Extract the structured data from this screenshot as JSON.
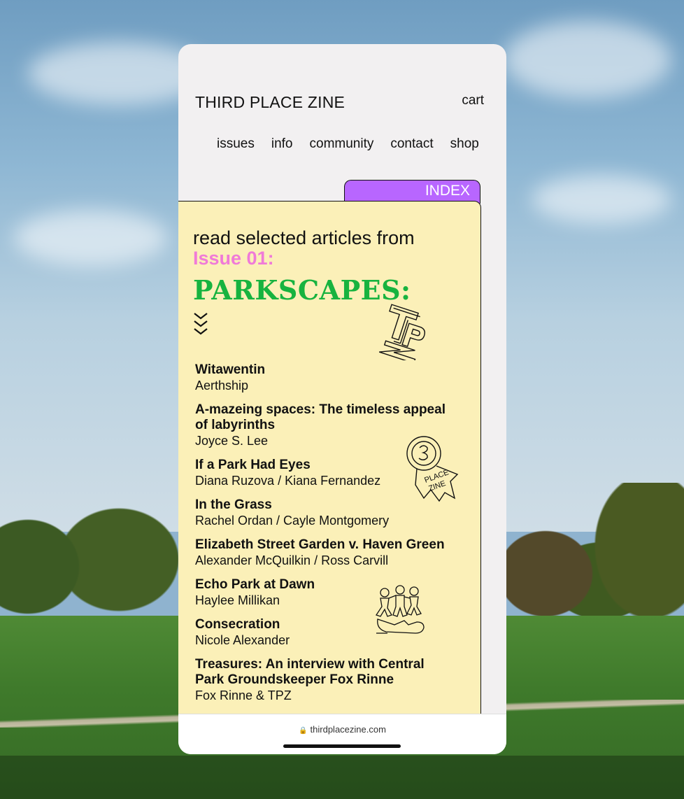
{
  "site": {
    "brand": "THIRD PLACE ZINE",
    "cart_label": "cart",
    "nav": [
      "issues",
      "info",
      "community",
      "contact",
      "shop"
    ]
  },
  "index_tab": "INDEX",
  "intro": {
    "lead": "read selected articles from ",
    "issue_label": "Issue 01:",
    "issue_title": "PARKSCAPES:"
  },
  "articles": [
    {
      "title": "Witawentin",
      "author": "Aerthship"
    },
    {
      "title": "A-mazeing spaces: The timeless appeal of labyrinths",
      "author": "Joyce S. Lee"
    },
    {
      "title": "If a Park Had Eyes",
      "author": "Diana Ruzova / Kiana Fernandez"
    },
    {
      "title": "In the Grass",
      "author": "Rachel Ordan / Cayle Montgomery"
    },
    {
      "title": "Elizabeth Street Garden v. Haven Green",
      "author": "Alexander McQuilkin / Ross Carvill"
    },
    {
      "title": "Echo Park at Dawn",
      "author": "Haylee Millikan"
    },
    {
      "title": "Consecration",
      "author": "Nicole Alexander"
    },
    {
      "title": "Treasures: An interview with Central Park Groundskeeper Fox Rinne",
      "author": "Fox Rinne & TPZ"
    }
  ],
  "browser": {
    "url": "thirdplacezine.com"
  },
  "colors": {
    "tab": "#b866ff",
    "card": "#fbf0b8",
    "issue_label": "#f07ad8",
    "issue_title": "#17b33f",
    "phone_bg": "#f2f0f1"
  },
  "icons": [
    "triple-chevron-down-icon",
    "lock-icon",
    "tpz-logo-doodle",
    "ribbon-badge-doodle",
    "people-doodle"
  ]
}
